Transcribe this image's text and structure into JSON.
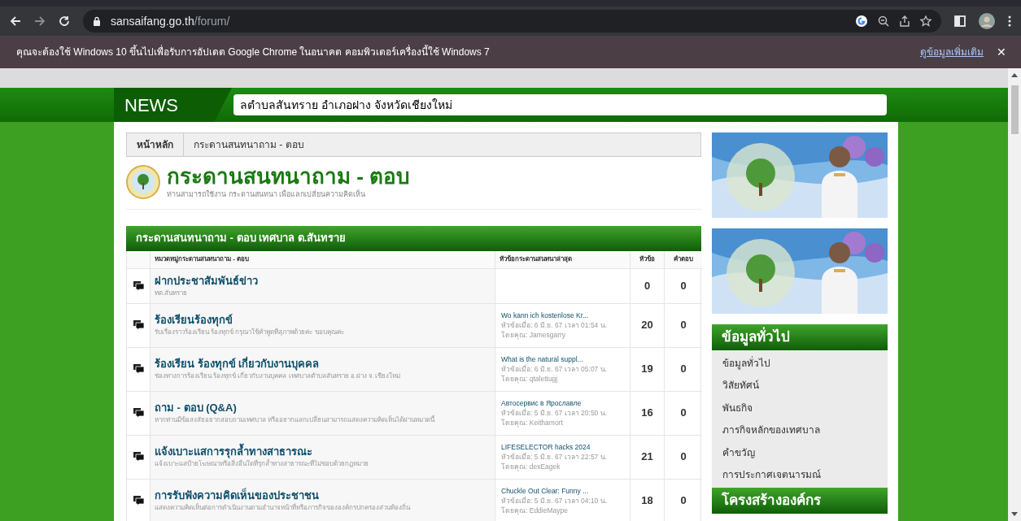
{
  "browser": {
    "url_host": "sansaifang.go.th",
    "url_path": "/forum/"
  },
  "infobar": {
    "message": "คุณจะต้องใช้ Windows 10 ขึ้นไปเพื่อรับการอัปเดต Google Chrome ในอนาคต คอมพิวเตอร์เครื่องนี้ใช้ Windows 7",
    "link": "ดูข้อมูลเพิ่มเติม",
    "close": "✕"
  },
  "news": {
    "label": "NEWS",
    "ticker": "ลตำบลสันทราย อำเภอฝาง จังหวัดเชียงใหม่"
  },
  "breadcrumb": [
    "หน้าหลัก",
    "กระดานสนทนาถาม - ตอบ"
  ],
  "forum": {
    "title": "กระดานสนทนาถาม - ตอบ",
    "subtitle": "ท่านสามารถใช้งาน กระดานสนทนา เพื่อแลกเปลี่ยนความคิดเห็น"
  },
  "table": {
    "title": "กระดานสนทนาถาม - ตอบ เทศบาล ต.สันทราย",
    "columns": [
      "หมวดหมู่กระดานสนทนาถาม - ตอบ",
      "หัวข้อกระดานสนทนาล่าสุด",
      "หัวข้อ",
      "คำตอบ"
    ],
    "rows": [
      {
        "name": "ฝากประชาสัมพันธ์ข่าว",
        "description": "ทต.สันทราย",
        "topics": "0",
        "replies": "0"
      },
      {
        "name": "ร้องเรียนร้องทุกข์",
        "description": "รับเรื่องราวร้องเรียน ร้องทุกข์ กรุณาใช้คำพูดที่สุภาพด้วยค่ะ ขอบคุณค่ะ",
        "latest": {
          "title": "Wo kann ich kostenlose Kr...",
          "date": "หัวข้อเมื่อ: 6 มิ.ย. 67 เวลา 01:54 น.",
          "by": "โดยคุณ: Jamesgarry"
        },
        "topics": "20",
        "replies": "0"
      },
      {
        "name": "ร้องเรียน ร้องทุกข์ เกี่ยวกับงานบุคคล",
        "description": "ช่องทางการร้องเรียน ร้องทุกข์ เกี่ยวกับงานบุคคล เทศบาลตำบลสันทราย อ.ฝาง จ.เชียงใหม่",
        "latest": {
          "title": "What is the natural suppl...",
          "date": "หัวข้อเมื่อ: 6 มิ.ย. 67 เวลา 05:07 น.",
          "by": "โดยคุณ: qtalettugj"
        },
        "topics": "19",
        "replies": "0"
      },
      {
        "name": "ถาม - ตอบ (Q&A)",
        "description": "หากท่านมีข้อสงสัยอยากสอบถามเทศบาล หรืออยากแลกเปลี่ยนสามารถแสดงความคิดเห็นได้ผ่านหมวดนี้",
        "latest": {
          "title": "Автосервис в Ярославле",
          "date": "หัวข้อเมื่อ: 5 มิ.ย. 67 เวลา 20:50 น.",
          "by": "โดยคุณ: Keithamort"
        },
        "topics": "16",
        "replies": "0"
      },
      {
        "name": "แจ้งเบาะแสการรุกล้ำทางสาธารณะ",
        "description": "แจ้งเบาะแสป้ายโฆษณาหรือสิ่งอื่นใดที่รุกล้ำทางสาธารณะที่ไม่ชอบด้วยกฎหมาย",
        "latest": {
          "title": "LIFESELECTOR hacks 2024",
          "date": "หัวข้อเมื่อ: 5 มิ.ย. 67 เวลา 22:57 น.",
          "by": "โดยคุณ: dexEagek"
        },
        "topics": "21",
        "replies": "0"
      },
      {
        "name": "การรับฟังความคิดเห็นของประชาชน",
        "description": "แสดงความคิดเห็นต่อการดำเนินงานตามอำนาจหน้าที่หรือภารกิจขององค์กรปกครองส่วนท้องถิ่น",
        "latest": {
          "title": "Chuckle Out Clear: Funny ...",
          "date": "หัวข้อเมื่อ: 5 มิ.ย. 67 เวลา 04:10 น.",
          "by": "โดยคุณ: EddieMaype"
        },
        "topics": "18",
        "replies": "0"
      }
    ]
  },
  "sidebar": {
    "sections": [
      {
        "title": "ข้อมูลทั่วไป",
        "items": [
          "ข้อมูลทั่วไป",
          "วิสัยทัศน์",
          "พันธกิจ",
          "ภารกิจหลักของเทศบาล",
          "คำขวัญ",
          "การประกาศเจตนารมณ์"
        ]
      },
      {
        "title": "โครงสร้างองค์กร"
      }
    ]
  }
}
